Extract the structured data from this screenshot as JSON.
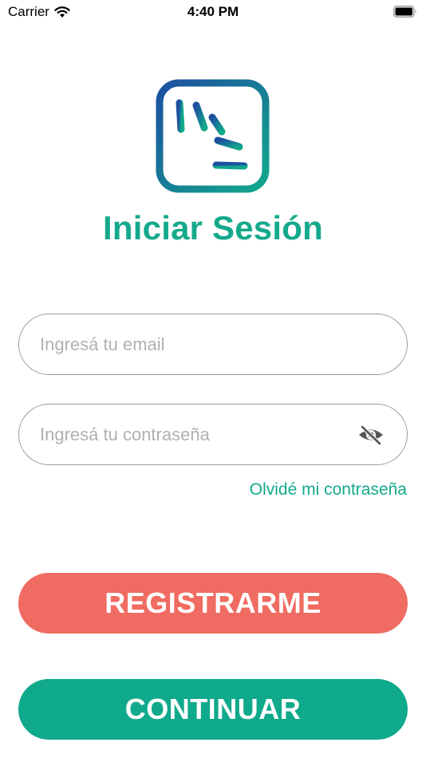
{
  "status_bar": {
    "carrier": "Carrier",
    "time": "4:40 PM"
  },
  "login": {
    "title": "Iniciar Sesión",
    "email_placeholder": "Ingresá tu email",
    "email_value": "",
    "password_placeholder": "Ingresá tu contraseña",
    "password_value": "",
    "forgot_password": "Olvidé mi contraseña",
    "register_button": "REGISTRARME",
    "continue_button": "CONTINUAR"
  },
  "icons": {
    "logo": "app-logo-icon",
    "password_visibility": "eye-slash-icon",
    "wifi": "wifi-icon",
    "battery": "battery-icon"
  },
  "colors": {
    "brand_green": "#14a98c",
    "register_red": "#f06b61",
    "continue_green": "#0fa98b",
    "logo_gradient_start": "#1c4fa0",
    "logo_gradient_end": "#12a88c"
  }
}
